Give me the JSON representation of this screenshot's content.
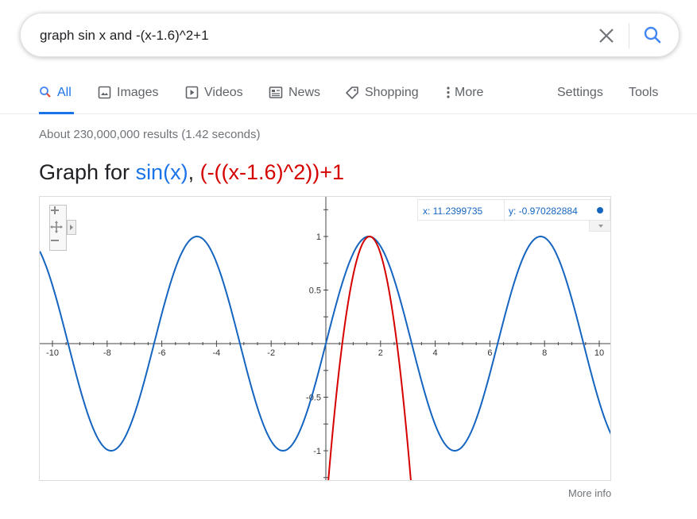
{
  "search": {
    "query": "graph sin x and -(x-1.6)^2+1",
    "clear_icon": "close-icon",
    "search_icon": "search-icon"
  },
  "tabs": [
    {
      "label": "All",
      "icon": "search-icon",
      "active": true
    },
    {
      "label": "Images",
      "icon": "image-icon"
    },
    {
      "label": "Videos",
      "icon": "play-icon"
    },
    {
      "label": "News",
      "icon": "news-icon"
    },
    {
      "label": "Shopping",
      "icon": "tag-icon"
    },
    {
      "label": "More",
      "icon": "more-vert-icon"
    }
  ],
  "tools": {
    "settings": "Settings",
    "tools": "Tools"
  },
  "stats": "About 230,000,000 results (1.42 seconds)",
  "graph": {
    "title_prefix": "Graph for ",
    "func1": "sin(x)",
    "separator": ", ",
    "func2": "(-((x-1.6)^2))+1",
    "coord_x": "x: 11.2399735",
    "coord_y": "y: -0.970282884",
    "more_info": "More info"
  },
  "colors": {
    "accent": "#1a73e8",
    "series1": "#1565c0",
    "series2": "#d50000"
  },
  "chart_data": {
    "type": "line",
    "title": "",
    "xlim": [
      -10.5,
      10.5
    ],
    "ylim": [
      -1.3,
      1.3
    ],
    "x_ticks": [
      -10,
      -8,
      -6,
      -4,
      -2,
      2,
      4,
      6,
      8,
      10
    ],
    "y_ticks": [
      -1,
      -0.5,
      0.5,
      1
    ],
    "y_tick_labels": [
      "-1",
      "-0.5",
      "0.5",
      "1"
    ],
    "grid": false,
    "series": [
      {
        "name": "sin(x)",
        "expression": "sin(x)",
        "color": "#1565c0"
      },
      {
        "name": "(-((x-1.6)^2))+1",
        "expression": "-(x-1.6)^2+1",
        "color": "#d50000"
      }
    ]
  }
}
